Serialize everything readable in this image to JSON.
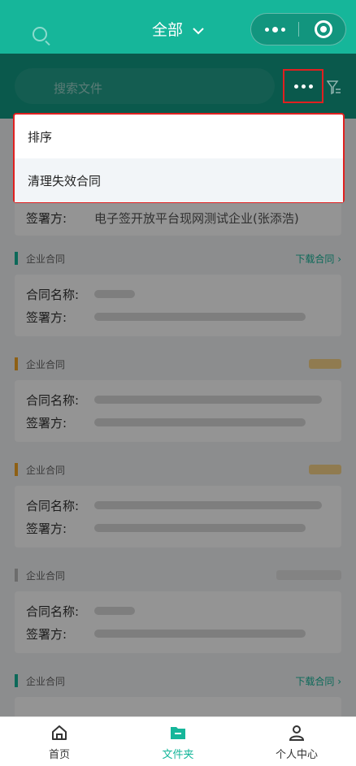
{
  "header": {
    "title": "全部"
  },
  "search": {
    "placeholder": "搜索文件"
  },
  "menu": {
    "items": [
      {
        "label": "排序"
      },
      {
        "label": "清理失效合同"
      }
    ]
  },
  "contracts": {
    "partial_signer_label": "签署方:",
    "partial_signer_value": "电子签开放平台现网测试企业(张添浩)",
    "type_label": "企业合同",
    "download_label": "下载合同",
    "name_label": "合同名称:",
    "signer_label": "签署方:"
  },
  "tabbar": {
    "items": [
      {
        "label": "首页"
      },
      {
        "label": "文件夹"
      },
      {
        "label": "个人中心"
      }
    ]
  },
  "colors": {
    "brand": "#16b69a",
    "highlight": "#e02020"
  }
}
